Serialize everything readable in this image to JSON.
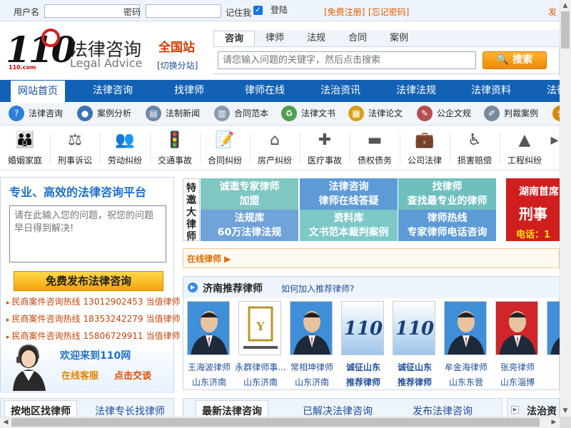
{
  "topbar": {
    "username_label": "用户名",
    "password_label": "密码",
    "remember_label": "记住我",
    "login_button": "登陆",
    "register_link": "[免费注册]",
    "forgot_link": "[忘记密码]",
    "right_link": "发"
  },
  "logo": {
    "number": "110",
    "sub": "110.com",
    "cn": "法律咨询",
    "en": "Legal Advice"
  },
  "region": {
    "name": "全国站",
    "switch": "[切换分站]"
  },
  "search": {
    "tabs": [
      "咨询",
      "律师",
      "法规",
      "合同",
      "案例"
    ],
    "placeholder": "请您输入问题的关键字，然后点击搜索",
    "button": "搜索"
  },
  "mainnav": [
    "网站首页",
    "法律咨询",
    "找律师",
    "律师在线",
    "法治资讯",
    "法律法规",
    "法律资料",
    "法律"
  ],
  "subnav": [
    {
      "label": "法律咨询",
      "icon": "question-icon",
      "color": "#2d7fd8"
    },
    {
      "label": "案例分析",
      "icon": "people-icon",
      "color": "#3c73b6"
    },
    {
      "label": "法制新闻",
      "icon": "newspaper-icon",
      "color": "#6d88a8"
    },
    {
      "label": "合同范本",
      "icon": "document-icon",
      "color": "#8a9bb0"
    },
    {
      "label": "法律文书",
      "icon": "recycle-icon",
      "color": "#4f9f4f"
    },
    {
      "label": "法律论文",
      "icon": "book-icon",
      "color": "#d6a21c"
    },
    {
      "label": "公企文规",
      "icon": "clipboard-icon",
      "color": "#b55050"
    },
    {
      "label": "判裁案例",
      "icon": "pen-icon",
      "color": "#7a8a9c"
    },
    {
      "label": "",
      "icon": "more-icon",
      "color": "#d68a00"
    }
  ],
  "categories": [
    {
      "label": "婚姻家庭",
      "icon": "family-icon",
      "glyph": "👪"
    },
    {
      "label": "刑事诉讼",
      "icon": "gavel-icon",
      "glyph": "⚖"
    },
    {
      "label": "劳动纠纷",
      "icon": "workers-icon",
      "glyph": "👥"
    },
    {
      "label": "交通事故",
      "icon": "traffic-light-icon",
      "glyph": "🚦"
    },
    {
      "label": "合同纠纷",
      "icon": "contract-icon",
      "glyph": "📝"
    },
    {
      "label": "房产纠纷",
      "icon": "house-icon",
      "glyph": "⌂"
    },
    {
      "label": "医疗事故",
      "icon": "medical-kit-icon",
      "glyph": "✚"
    },
    {
      "label": "债权债务",
      "icon": "card-icon",
      "glyph": "▬"
    },
    {
      "label": "公司法律",
      "icon": "briefcase-icon",
      "glyph": "💼"
    },
    {
      "label": "损害赔偿",
      "icon": "wheelchair-icon",
      "glyph": "♿"
    },
    {
      "label": "工程纠纷",
      "icon": "cone-icon",
      "glyph": "▲"
    }
  ],
  "left_panel": {
    "title": "专业、高效的法律咨询平台",
    "ask_placeholder": "请在此输入您的问题，祝您的问题早日得到解决!",
    "post_button": "免费发布法律咨询",
    "hotlines": [
      {
        "prefix": "民商案件咨询热线",
        "number": "13012902453",
        "duty": "当值律师"
      },
      {
        "prefix": "民商案件咨询热线",
        "number": "18353242279",
        "duty": "当值律师"
      },
      {
        "prefix": "民商案件咨询热线",
        "number": "15806729911",
        "duty": "当值律师"
      }
    ],
    "welcome": "欢迎来到110网",
    "service1": "在线客服",
    "service2": "点击交谈"
  },
  "invite": {
    "label": "特邀大律师",
    "tiles": [
      {
        "l1": "诚邀专家律师",
        "l2": "加盟",
        "color": "#7fc7c0"
      },
      {
        "l1": "法律咨询",
        "l2": "律师在线答疑",
        "color": "#5e9bd6"
      },
      {
        "l1": "找律师",
        "l2": "查找最专业的律师",
        "color": "#6fbfbf"
      },
      {
        "l1": "法规库",
        "l2": "60万法律法规",
        "color": "#6fa3d9"
      },
      {
        "l1": "资料库",
        "l2": "文书范本裁判案例",
        "color": "#7ec8c8"
      },
      {
        "l1": "律师热线",
        "l2": "专家律师电话咨询",
        "color": "#5d9bd6"
      }
    ],
    "banner": {
      "l1": "湖南首席",
      "l2": "刑事",
      "l3": "电话：1"
    }
  },
  "online": {
    "title": "在线律师 ▶"
  },
  "recommend": {
    "title": "济南推荐律师",
    "how": "如何加入推荐律师?",
    "lawyers": [
      {
        "name": "王海波律师",
        "loc": "山东济南",
        "bold": false,
        "photo": "person"
      },
      {
        "name": "永群律师事...",
        "loc": "山东济南",
        "bold": false,
        "photo": "firm-logo"
      },
      {
        "name": "常相坤律师",
        "loc": "山东济南",
        "bold": false,
        "photo": "person"
      },
      {
        "name": "诚征山东",
        "loc": "推荐律师",
        "bold": true,
        "photo": "110-logo"
      },
      {
        "name": "诚征山东",
        "loc": "推荐律师",
        "bold": true,
        "photo": "110-logo"
      },
      {
        "name": "牟金海律师",
        "loc": "山东东营",
        "bold": false,
        "photo": "person"
      },
      {
        "name": "张亮律师",
        "loc": "山东淄博",
        "bold": false,
        "photo": "person-red"
      },
      {
        "name": "邓",
        "loc": "山",
        "bold": false,
        "photo": "person"
      }
    ]
  },
  "bottom_tabs": {
    "left": [
      "按地区找律师",
      "法律专长找律师"
    ],
    "middle": [
      "最新法律咨询",
      "已解决法律咨询",
      "发布法律咨询"
    ],
    "right": "法治资"
  },
  "colors": {
    "nav_blue": "#1361b4",
    "orange": "#e35c00",
    "link_blue": "#1f4e9a"
  }
}
